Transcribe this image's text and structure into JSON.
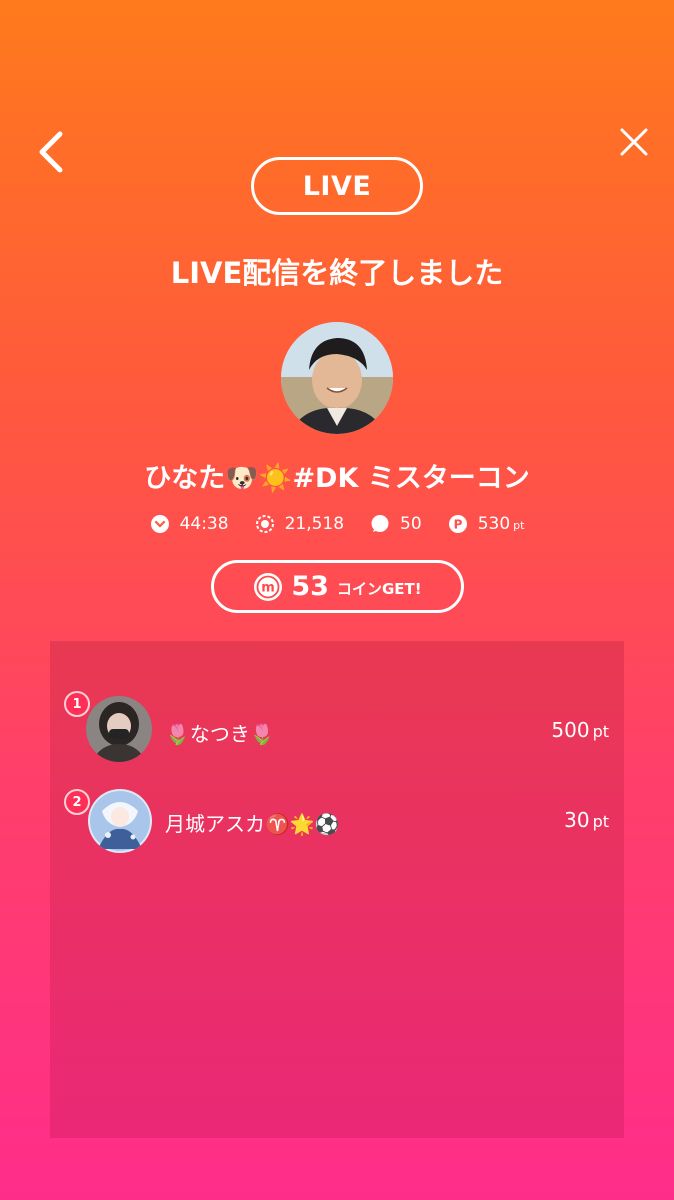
{
  "header": {
    "live_badge": "LIVE",
    "title": "LIVE配信を終了しました"
  },
  "icons": {
    "back": "chevron-left-icon",
    "close": "close-icon"
  },
  "streamer": {
    "name": "ひなた🐶☀️#DK ミスターコン"
  },
  "stats": {
    "duration": "44:38",
    "viewers": "21,518",
    "comments": "50",
    "points": "530",
    "points_unit": "pt"
  },
  "coin": {
    "amount": "53",
    "suffix": "コインGET!"
  },
  "ranking": [
    {
      "rank": "1",
      "name": "🌷なつき🌷",
      "points": "500",
      "unit": "pt"
    },
    {
      "rank": "2",
      "name": "月城アスカ♈️🌟⚽️",
      "points": "30",
      "unit": "pt"
    }
  ],
  "colors": {
    "gradient_top": "#ff7a1c",
    "gradient_bottom": "#ff2d8a",
    "rank_badge": "#ff2f58"
  }
}
